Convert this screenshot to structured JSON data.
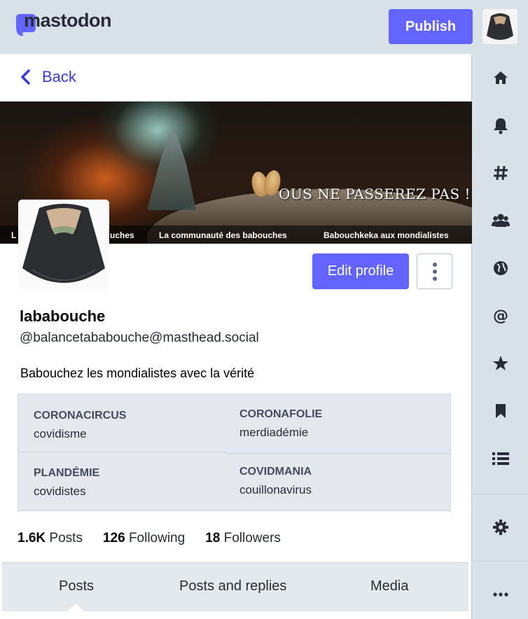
{
  "header": {
    "logo_text": "mastodon",
    "publish_label": "Publish"
  },
  "back": {
    "label": "Back"
  },
  "banner": {
    "title": "OUS NE PASSEREZ PAS !",
    "strip": [
      "L",
      "uches",
      "La communauté des babouches",
      "Babouchkeka aux mondialistes"
    ]
  },
  "profile": {
    "edit_label": "Edit profile",
    "display_name": "lababouche",
    "acct": "@balancetababouche@masthead.social",
    "bio": "Babouchez les mondialistes avec la vérité",
    "fields": [
      {
        "name": "CORONACIRCUS",
        "value": "covidisme"
      },
      {
        "name": "CORONAFOLIE",
        "value": "merdiadémie"
      },
      {
        "name": "PLANDÉMIE",
        "value": "covidistes"
      },
      {
        "name": "COVIDMANIA",
        "value": "couillonavirus"
      }
    ],
    "counts": [
      {
        "value": "1.6K",
        "label": "Posts"
      },
      {
        "value": "126",
        "label": "Following"
      },
      {
        "value": "18",
        "label": "Followers"
      }
    ]
  },
  "tabs": [
    {
      "label": "Posts",
      "active": true
    },
    {
      "label": "Posts and replies",
      "active": false
    },
    {
      "label": "Media",
      "active": false
    }
  ],
  "nav": [
    "home-icon",
    "bell-icon",
    "hashtag-icon",
    "users-icon",
    "globe-icon",
    "at-icon",
    "star-icon",
    "bookmark-icon",
    "list-icon",
    "gear-icon",
    "ellipsis-icon"
  ],
  "colors": {
    "accent": "#6364ff",
    "link": "#3a3ae0",
    "background": "#d9e1e8"
  }
}
